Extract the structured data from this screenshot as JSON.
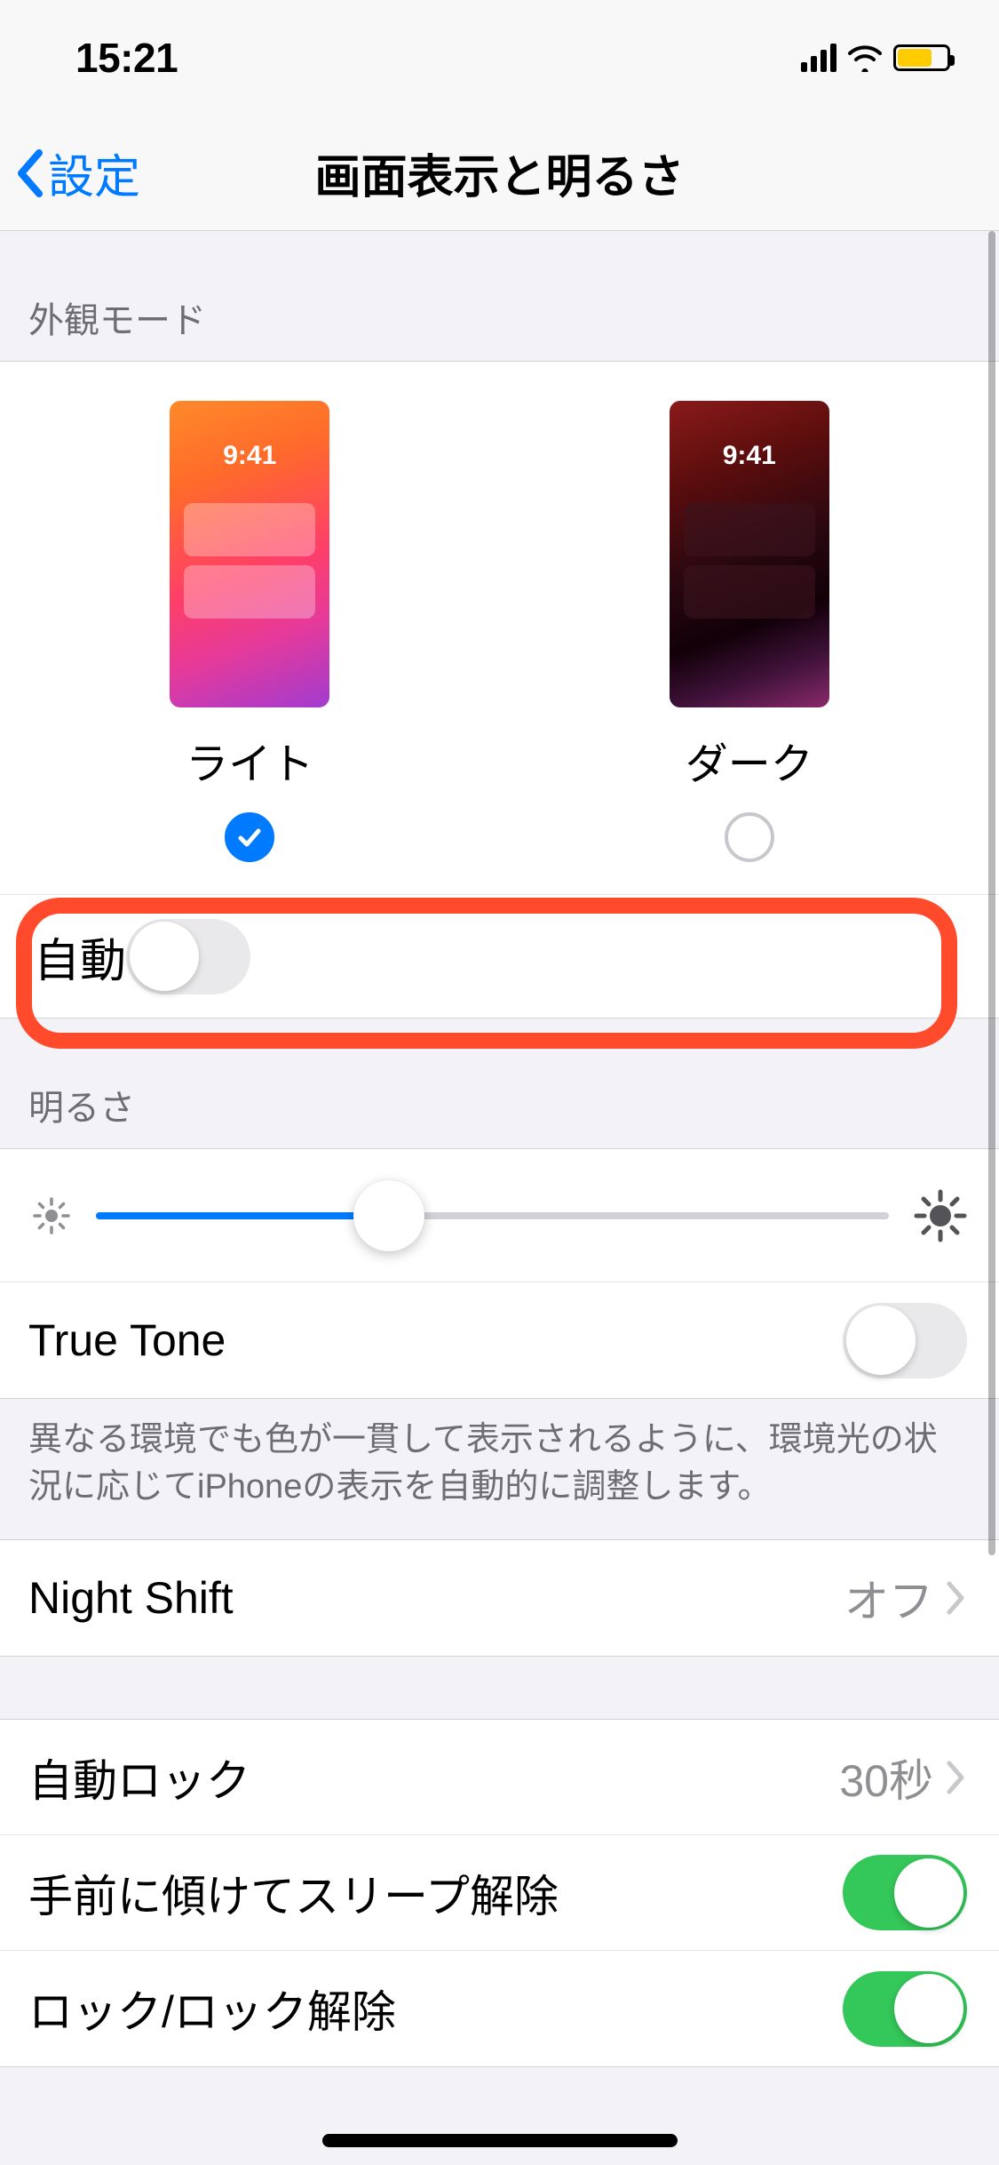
{
  "status": {
    "time": "15:21"
  },
  "nav": {
    "back": "設定",
    "title": "画面表示と明るさ"
  },
  "appearance": {
    "header": "外観モード",
    "preview_time": "9:41",
    "light_label": "ライト",
    "dark_label": "ダーク",
    "selected": "light",
    "auto_label": "自動",
    "auto_on": false
  },
  "brightness": {
    "header": "明るさ",
    "value_percent": 37,
    "truetone_label": "True Tone",
    "truetone_on": false,
    "truetone_footer": "異なる環境でも色が一貫して表示されるように、環境光の状況に応じてiPhoneの表示を自動的に調整します。"
  },
  "nightshift": {
    "label": "Night Shift",
    "value": "オフ"
  },
  "autolock": {
    "label": "自動ロック",
    "value": "30秒"
  },
  "raise": {
    "label": "手前に傾けてスリープ解除",
    "on": true
  },
  "lock": {
    "label": "ロック/ロック解除",
    "on": true
  }
}
